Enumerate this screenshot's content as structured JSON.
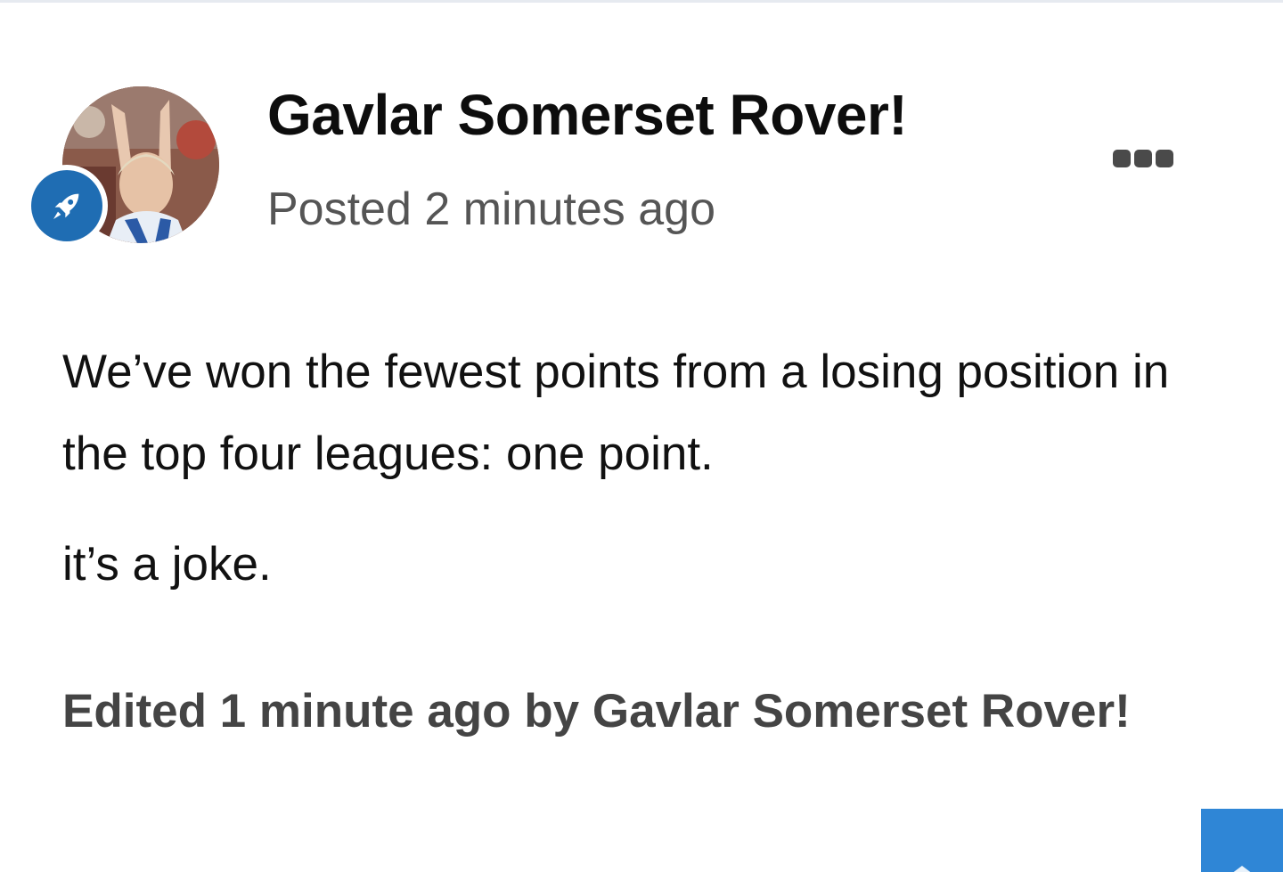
{
  "post": {
    "author": "Gavlar Somerset Rover!",
    "posted_time": "Posted 2 minutes ago",
    "content": {
      "paragraphs": [
        "We’ve won the fewest points from a losing position in the top four leagues: one point.",
        "it’s a joke."
      ]
    },
    "edited_note": "Edited 1 minute ago by Gavlar Somerset Rover!"
  },
  "icons": {
    "badge": "rocket-icon",
    "menu": "more-options-icon",
    "fab": "scroll-up-icon"
  },
  "colors": {
    "badge": "#1f6db3",
    "fab": "#2f86d6",
    "meta_text": "#555555",
    "edited_text": "#444444"
  }
}
